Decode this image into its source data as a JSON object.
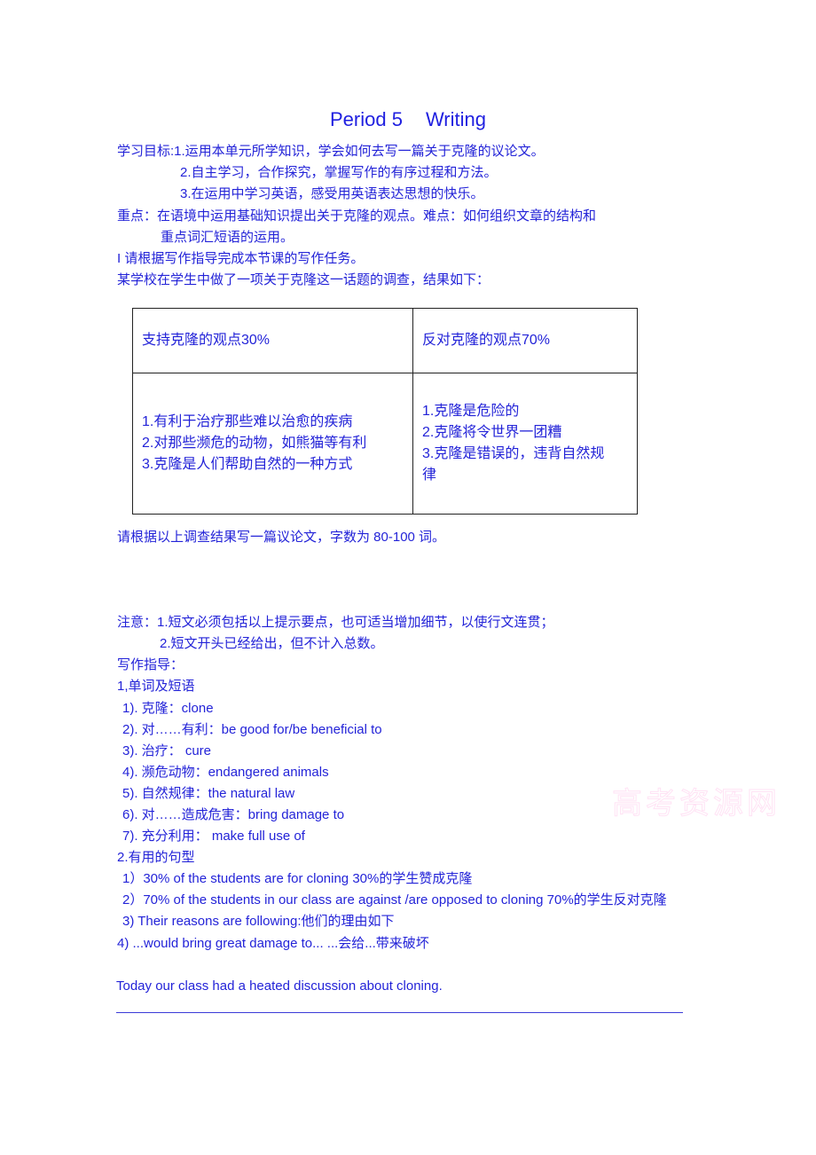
{
  "title": {
    "part1": "Period 5",
    "part2": "Writing"
  },
  "objectives": {
    "label": "学习目标:",
    "items": [
      "1.运用本单元所学知识，学会如何去写一篇关于克隆的议论文。",
      "2.自主学习，合作探究，掌握写作的有序过程和方法。",
      "3.在运用中学习英语，感受用英语表达思想的快乐。"
    ]
  },
  "key_points": {
    "line1": "重点：在语境中运用基础知识提出关于克隆的观点。难点：如何组织文章的结构和",
    "line2": "重点词汇短语的运用。"
  },
  "task_intro": "I 请根据写作指导完成本节课的写作任务。",
  "survey_intro": "某学校在学生中做了一项关于克隆这一话题的调查，结果如下：",
  "survey_table": {
    "headers": [
      "支持克隆的观点30%",
      "反对克隆的观点70%"
    ],
    "support": [
      "1.有利于治疗那些难以治愈的疾病",
      "2.对那些濒危的动物，如熊猫等有利",
      "3.克隆是人们帮助自然的一种方式"
    ],
    "oppose": [
      "1.克隆是危险的",
      "2.克隆将令世界一团糟",
      "3.克隆是错误的，违背自然规",
      "律"
    ]
  },
  "instruction": "请根据以上调查结果写一篇议论文，字数为 80-100 词。",
  "notes": {
    "line1": "注意：1.短文必须包括以上提示要点，也可适当增加细节，以使行文连贯；",
    "line2": "2.短文开头已经给出，但不计入总数。"
  },
  "guide_heading": "写作指导：",
  "vocab_heading": "1,单词及短语",
  "vocab": [
    "1). 克隆：clone",
    "2). 对……有利：be good for/be beneficial to",
    "3). 治疗：  cure",
    "4). 濒危动物：endangered    animals",
    "5). 自然规律：the natural law",
    "6). 对……造成危害：bring damage to",
    "7). 充分利用：  make full use of"
  ],
  "sentences_heading": "2.有用的句型",
  "sentences": [
    "1）30% of the students are for cloning    30%的学生赞成克隆",
    "2）70% of the students in our class are against /are opposed to cloning    70%的学生反对克隆",
    "3)   Their reasons are following:他们的理由如下",
    "4)   ...would bring great damage to...      ...会给...带来破坏"
  ],
  "opening_sentence": "Today our class had a heated discussion about cloning.",
  "watermark": "高考资源网"
}
